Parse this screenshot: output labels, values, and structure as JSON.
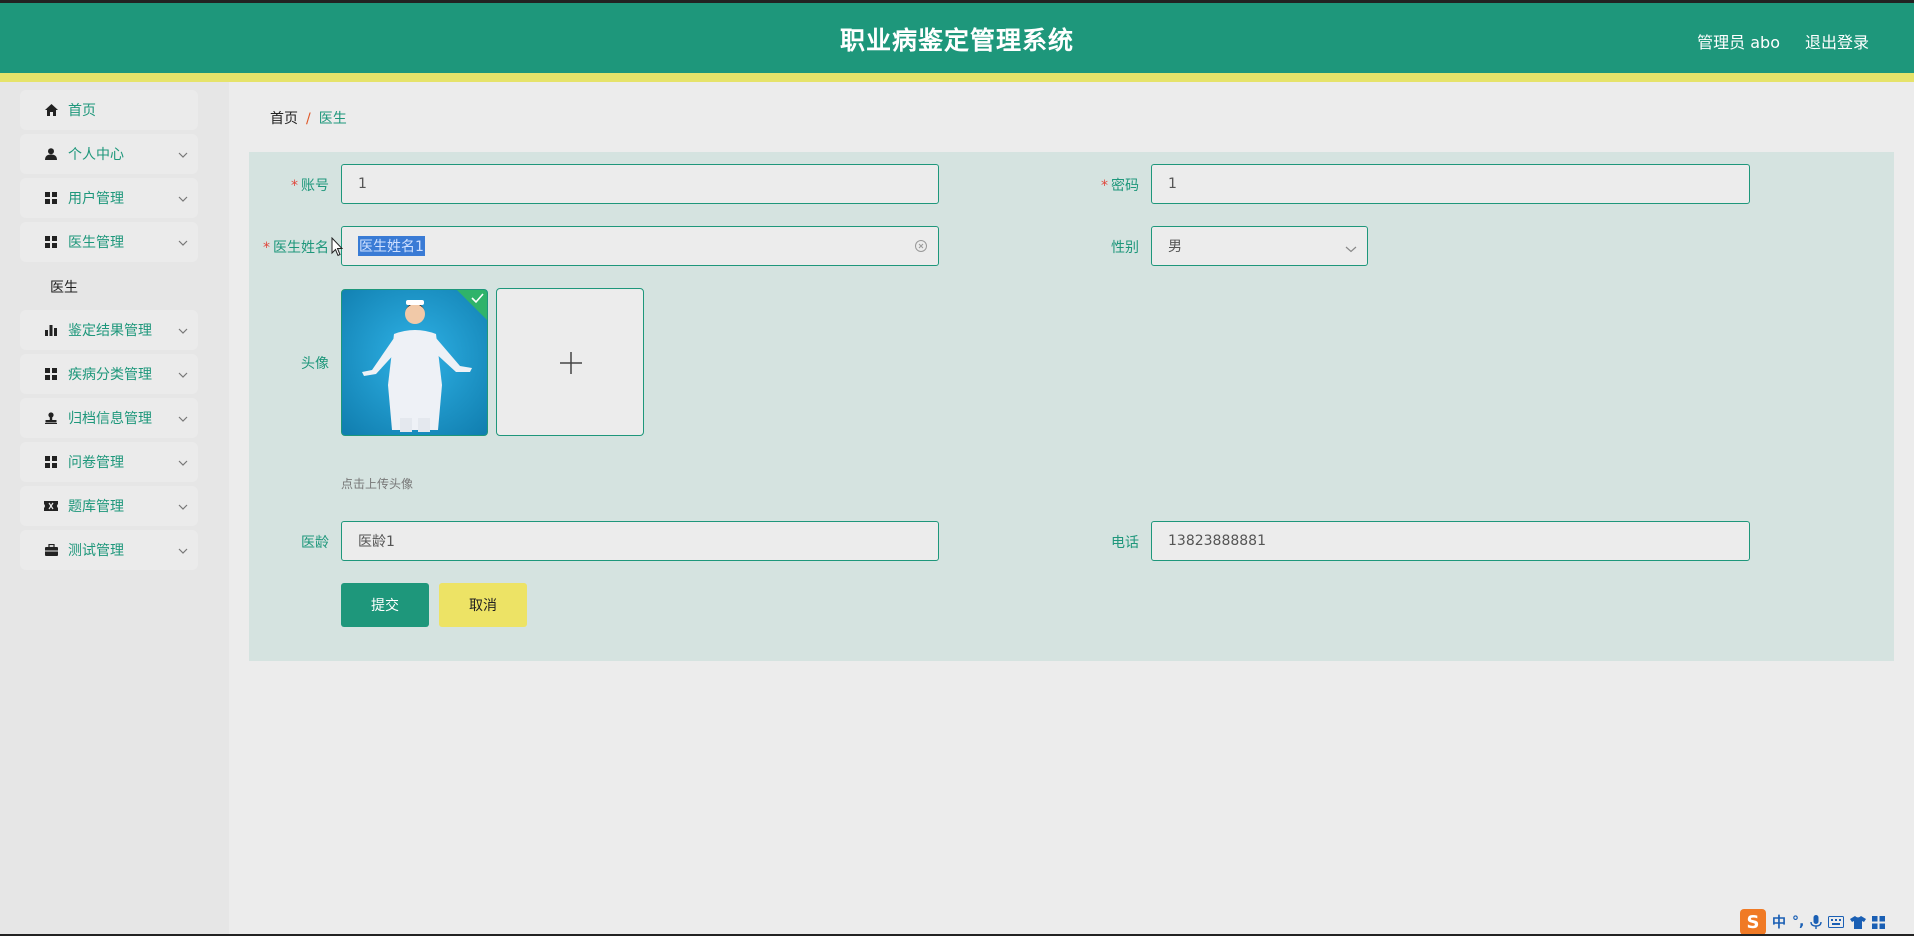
{
  "header": {
    "title": "职业病鉴定管理系统",
    "user": "管理员 abo",
    "logout": "退出登录"
  },
  "sidebar": {
    "items": [
      {
        "label": "首页",
        "icon": "home-icon",
        "expandable": false
      },
      {
        "label": "个人中心",
        "icon": "user-icon",
        "expandable": true
      },
      {
        "label": "用户管理",
        "icon": "grid-icon",
        "expandable": true
      },
      {
        "label": "医生管理",
        "icon": "grid-icon",
        "expandable": true
      },
      {
        "label": "鉴定结果管理",
        "icon": "bar-chart-icon",
        "expandable": true
      },
      {
        "label": "疾病分类管理",
        "icon": "grid-icon",
        "expandable": true
      },
      {
        "label": "归档信息管理",
        "icon": "stamp-icon",
        "expandable": true
      },
      {
        "label": "问卷管理",
        "icon": "grid-icon",
        "expandable": true
      },
      {
        "label": "题库管理",
        "icon": "ticket-icon",
        "expandable": true
      },
      {
        "label": "测试管理",
        "icon": "briefcase-icon",
        "expandable": true
      }
    ],
    "submenu": "医生"
  },
  "breadcrumb": {
    "home": "首页",
    "separator": "/",
    "current": "医生"
  },
  "form": {
    "account_label": "账号",
    "account_value": "1",
    "password_label": "密码",
    "password_value": "1",
    "name_label": "医生姓名",
    "name_value": "医生姓名1",
    "gender_label": "性别",
    "gender_value": "男",
    "avatar_label": "头像",
    "upload_hint": "点击上传头像",
    "age_label": "医龄",
    "age_value": "医龄1",
    "phone_label": "电话",
    "phone_value": "13823888881",
    "submit_label": "提交",
    "cancel_label": "取消"
  },
  "ime": {
    "logo": "S",
    "mode": "中",
    "punct": "°,"
  },
  "colors": {
    "primary": "#1e977b",
    "accent_yellow": "#e6e36a",
    "required": "#e0453a"
  }
}
